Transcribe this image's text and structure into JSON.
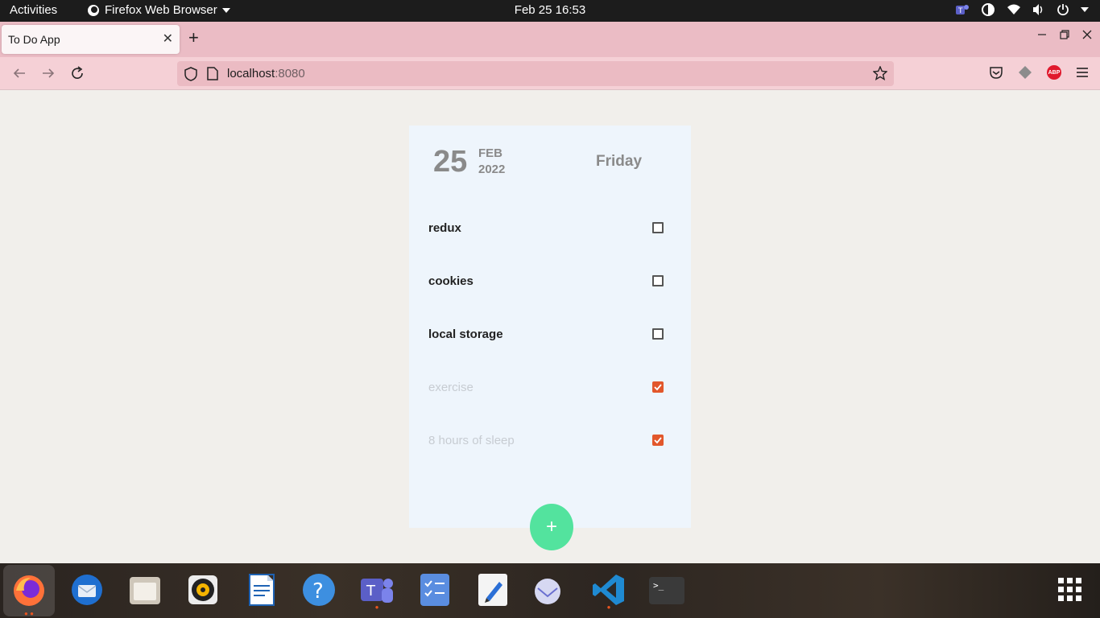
{
  "system": {
    "activities": "Activities",
    "app_menu": "Firefox Web Browser",
    "clock": "Feb 25  16:53"
  },
  "browser": {
    "tab_title": "To Do App",
    "url_host": "localhost",
    "url_port": ":8080"
  },
  "todo_app": {
    "day": "25",
    "month": "FEB",
    "year": "2022",
    "weekday": "Friday",
    "items": [
      {
        "label": "redux",
        "done": false
      },
      {
        "label": "cookies",
        "done": false
      },
      {
        "label": "local storage",
        "done": false
      },
      {
        "label": "exercise",
        "done": true
      },
      {
        "label": "8 hours of sleep",
        "done": true
      }
    ],
    "add_button": "+"
  },
  "colors": {
    "tab_strip": "#ebbcc5",
    "nav_bar": "#f5d0d6",
    "card": "#eef5fc",
    "checked": "#e2572b",
    "add_button": "#53e39e"
  },
  "dock": {
    "apps": [
      "firefox-icon",
      "thunderbird-icon",
      "files-icon",
      "rhythmbox-icon",
      "writer-icon",
      "help-icon",
      "teams-icon",
      "tasks-icon",
      "text-editor-icon",
      "mail-icon",
      "vscode-icon",
      "terminal-icon"
    ]
  }
}
